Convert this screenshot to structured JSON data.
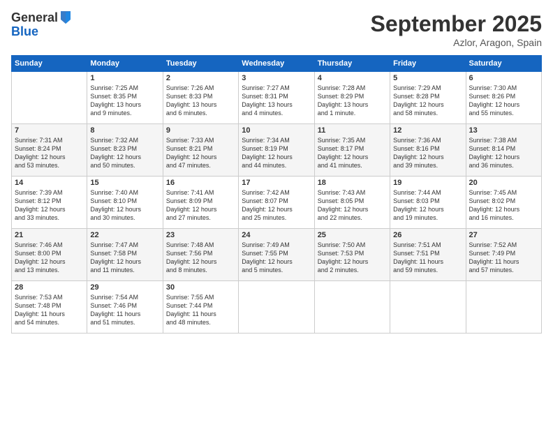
{
  "logo": {
    "general": "General",
    "blue": "Blue"
  },
  "header": {
    "month": "September 2025",
    "location": "Azlor, Aragon, Spain"
  },
  "days_of_week": [
    "Sunday",
    "Monday",
    "Tuesday",
    "Wednesday",
    "Thursday",
    "Friday",
    "Saturday"
  ],
  "weeks": [
    [
      {
        "day": "",
        "info": ""
      },
      {
        "day": "1",
        "info": "Sunrise: 7:25 AM\nSunset: 8:35 PM\nDaylight: 13 hours\nand 9 minutes."
      },
      {
        "day": "2",
        "info": "Sunrise: 7:26 AM\nSunset: 8:33 PM\nDaylight: 13 hours\nand 6 minutes."
      },
      {
        "day": "3",
        "info": "Sunrise: 7:27 AM\nSunset: 8:31 PM\nDaylight: 13 hours\nand 4 minutes."
      },
      {
        "day": "4",
        "info": "Sunrise: 7:28 AM\nSunset: 8:29 PM\nDaylight: 13 hours\nand 1 minute."
      },
      {
        "day": "5",
        "info": "Sunrise: 7:29 AM\nSunset: 8:28 PM\nDaylight: 12 hours\nand 58 minutes."
      },
      {
        "day": "6",
        "info": "Sunrise: 7:30 AM\nSunset: 8:26 PM\nDaylight: 12 hours\nand 55 minutes."
      }
    ],
    [
      {
        "day": "7",
        "info": "Sunrise: 7:31 AM\nSunset: 8:24 PM\nDaylight: 12 hours\nand 53 minutes."
      },
      {
        "day": "8",
        "info": "Sunrise: 7:32 AM\nSunset: 8:23 PM\nDaylight: 12 hours\nand 50 minutes."
      },
      {
        "day": "9",
        "info": "Sunrise: 7:33 AM\nSunset: 8:21 PM\nDaylight: 12 hours\nand 47 minutes."
      },
      {
        "day": "10",
        "info": "Sunrise: 7:34 AM\nSunset: 8:19 PM\nDaylight: 12 hours\nand 44 minutes."
      },
      {
        "day": "11",
        "info": "Sunrise: 7:35 AM\nSunset: 8:17 PM\nDaylight: 12 hours\nand 41 minutes."
      },
      {
        "day": "12",
        "info": "Sunrise: 7:36 AM\nSunset: 8:16 PM\nDaylight: 12 hours\nand 39 minutes."
      },
      {
        "day": "13",
        "info": "Sunrise: 7:38 AM\nSunset: 8:14 PM\nDaylight: 12 hours\nand 36 minutes."
      }
    ],
    [
      {
        "day": "14",
        "info": "Sunrise: 7:39 AM\nSunset: 8:12 PM\nDaylight: 12 hours\nand 33 minutes."
      },
      {
        "day": "15",
        "info": "Sunrise: 7:40 AM\nSunset: 8:10 PM\nDaylight: 12 hours\nand 30 minutes."
      },
      {
        "day": "16",
        "info": "Sunrise: 7:41 AM\nSunset: 8:09 PM\nDaylight: 12 hours\nand 27 minutes."
      },
      {
        "day": "17",
        "info": "Sunrise: 7:42 AM\nSunset: 8:07 PM\nDaylight: 12 hours\nand 25 minutes."
      },
      {
        "day": "18",
        "info": "Sunrise: 7:43 AM\nSunset: 8:05 PM\nDaylight: 12 hours\nand 22 minutes."
      },
      {
        "day": "19",
        "info": "Sunrise: 7:44 AM\nSunset: 8:03 PM\nDaylight: 12 hours\nand 19 minutes."
      },
      {
        "day": "20",
        "info": "Sunrise: 7:45 AM\nSunset: 8:02 PM\nDaylight: 12 hours\nand 16 minutes."
      }
    ],
    [
      {
        "day": "21",
        "info": "Sunrise: 7:46 AM\nSunset: 8:00 PM\nDaylight: 12 hours\nand 13 minutes."
      },
      {
        "day": "22",
        "info": "Sunrise: 7:47 AM\nSunset: 7:58 PM\nDaylight: 12 hours\nand 11 minutes."
      },
      {
        "day": "23",
        "info": "Sunrise: 7:48 AM\nSunset: 7:56 PM\nDaylight: 12 hours\nand 8 minutes."
      },
      {
        "day": "24",
        "info": "Sunrise: 7:49 AM\nSunset: 7:55 PM\nDaylight: 12 hours\nand 5 minutes."
      },
      {
        "day": "25",
        "info": "Sunrise: 7:50 AM\nSunset: 7:53 PM\nDaylight: 12 hours\nand 2 minutes."
      },
      {
        "day": "26",
        "info": "Sunrise: 7:51 AM\nSunset: 7:51 PM\nDaylight: 11 hours\nand 59 minutes."
      },
      {
        "day": "27",
        "info": "Sunrise: 7:52 AM\nSunset: 7:49 PM\nDaylight: 11 hours\nand 57 minutes."
      }
    ],
    [
      {
        "day": "28",
        "info": "Sunrise: 7:53 AM\nSunset: 7:48 PM\nDaylight: 11 hours\nand 54 minutes."
      },
      {
        "day": "29",
        "info": "Sunrise: 7:54 AM\nSunset: 7:46 PM\nDaylight: 11 hours\nand 51 minutes."
      },
      {
        "day": "30",
        "info": "Sunrise: 7:55 AM\nSunset: 7:44 PM\nDaylight: 11 hours\nand 48 minutes."
      },
      {
        "day": "",
        "info": ""
      },
      {
        "day": "",
        "info": ""
      },
      {
        "day": "",
        "info": ""
      },
      {
        "day": "",
        "info": ""
      }
    ]
  ]
}
